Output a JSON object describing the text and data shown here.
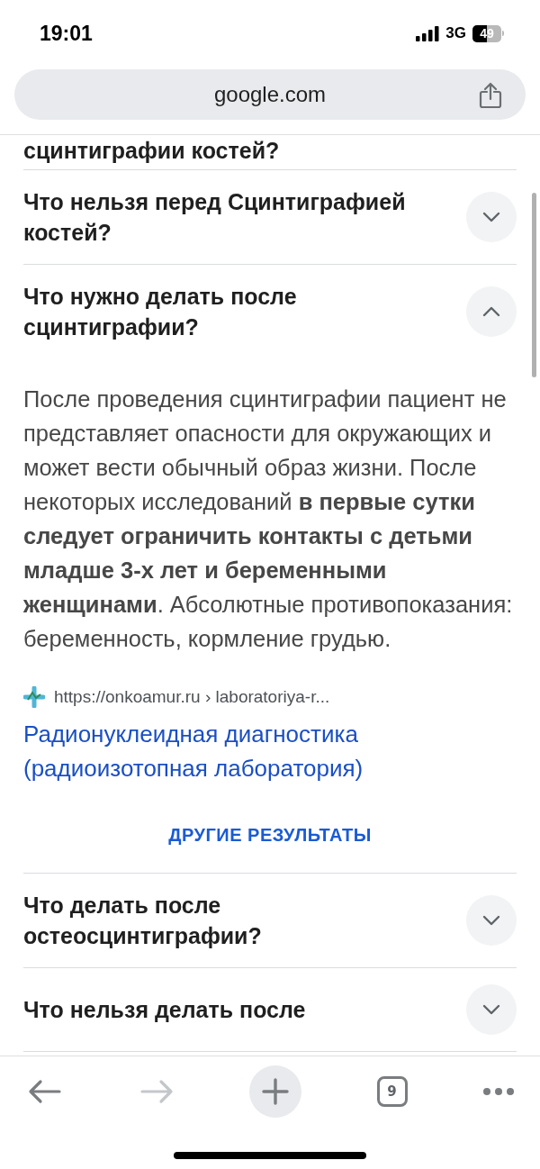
{
  "status_bar": {
    "time": "19:01",
    "network": "3G",
    "battery": "49"
  },
  "address_bar": {
    "url": "google.com"
  },
  "questions": [
    {
      "text": "сцинтиграфии костей?"
    },
    {
      "text": "Что нельзя перед Сцинтиграфией костей?",
      "expanded": false
    },
    {
      "text": "Что нужно делать после сцинтиграфии?",
      "expanded": true,
      "answer": "После проведения сцинтиграфии пациент не представляет опасности для окружающих и может вести обычный образ жизни. После некоторых исследований **в первые сутки следует ограничить контакты с детьми младше 3-х лет и беременными женщинами**. Абсолютные противопоказания: беременность, кормление грудью.",
      "source": {
        "url": "https://onkoamur.ru › laboratoriya-r...",
        "title": "Радионуклеидная диагностика (радиоизотопная лаборатория)"
      }
    }
  ],
  "more_button": "ДРУГИЕ РЕЗУЛЬТАТЫ",
  "more_questions": [
    {
      "text": "Что делать после остеосцинтиграфии?",
      "expanded": false
    },
    {
      "text": "Что нельзя делать после",
      "expanded": false
    }
  ],
  "toolbar": {
    "back_disabled": false,
    "forward_disabled": true,
    "tab_count": "9"
  }
}
